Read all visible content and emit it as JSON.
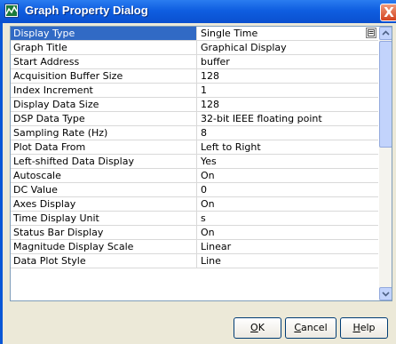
{
  "window": {
    "title": "Graph Property Dialog",
    "close_glyph": "X"
  },
  "properties": [
    {
      "name": "Display Type",
      "value": "Single Time",
      "selected": true
    },
    {
      "name": "Graph Title",
      "value": "Graphical Display"
    },
    {
      "name": "Start Address",
      "value": "buffer"
    },
    {
      "name": "Acquisition Buffer Size",
      "value": "128"
    },
    {
      "name": "Index Increment",
      "value": "1"
    },
    {
      "name": "Display Data Size",
      "value": "128"
    },
    {
      "name": "DSP Data Type",
      "value": "32-bit IEEE floating point"
    },
    {
      "name": "Sampling Rate (Hz)",
      "value": "8"
    },
    {
      "name": "Plot Data From",
      "value": "Left to Right"
    },
    {
      "name": "Left-shifted Data Display",
      "value": "Yes"
    },
    {
      "name": "Autoscale",
      "value": "On"
    },
    {
      "name": "DC Value",
      "value": "0"
    },
    {
      "name": "Axes Display",
      "value": "On"
    },
    {
      "name": "Time Display Unit",
      "value": "s"
    },
    {
      "name": "Status Bar Display",
      "value": "On"
    },
    {
      "name": "Magnitude Display Scale",
      "value": "Linear"
    },
    {
      "name": "Data Plot Style",
      "value": "Line"
    }
  ],
  "buttons": {
    "ok": {
      "mnemonic": "O",
      "rest": "K"
    },
    "cancel": {
      "mnemonic": "C",
      "rest": "ancel"
    },
    "help": {
      "mnemonic": "H",
      "rest": "elp"
    }
  },
  "colors": {
    "titlebar": "#0f5ee0",
    "selection": "#316ac5",
    "dialog_bg": "#ece9d8"
  },
  "icons": {
    "title": "graph-icon",
    "combo": "dropdown-list-icon",
    "close": "close-icon"
  }
}
